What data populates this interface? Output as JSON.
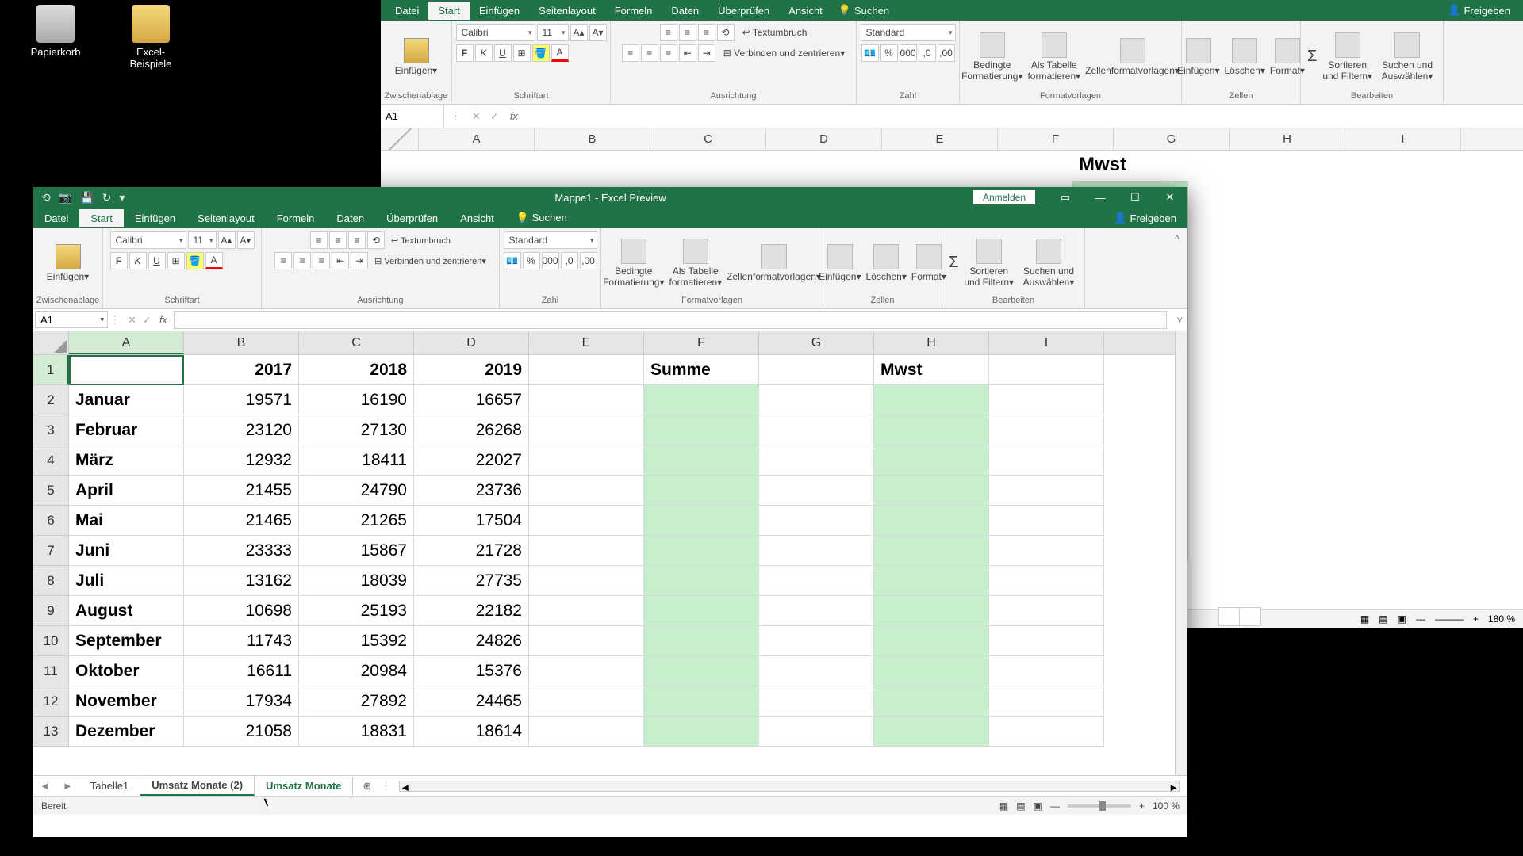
{
  "desktop": {
    "icon1": "Papierkorb",
    "icon2": "Excel-Beispiele"
  },
  "bg": {
    "tabs": [
      "Datei",
      "Start",
      "Einfügen",
      "Seitenlayout",
      "Formeln",
      "Daten",
      "Überprüfen",
      "Ansicht"
    ],
    "search": "Suchen",
    "share": "Freigeben",
    "font": "Calibri",
    "size": "11",
    "numfmt": "Standard",
    "groups": {
      "clipboard": "Zwischenablage",
      "font": "Schriftart",
      "align": "Ausrichtung",
      "number": "Zahl",
      "styles": "Formatvorlagen",
      "cells": "Zellen",
      "edit": "Bearbeiten"
    },
    "buttons": {
      "paste": "Einfügen",
      "wrap": "Textumbruch",
      "merge": "Verbinden und zentrieren",
      "condfmt": "Bedingte Formatierung",
      "table": "Als Tabelle formatieren",
      "cellstyles": "Zellenformatvorlagen",
      "insert": "Einfügen",
      "delete": "Löschen",
      "format": "Format",
      "sort": "Sortieren und Filtern",
      "find": "Suchen und Auswählen"
    },
    "namebox": "A1",
    "cols": [
      "A",
      "B",
      "C",
      "D",
      "E",
      "F",
      "G",
      "H",
      "I"
    ],
    "mwst": "Mwst",
    "zoom": "180 %"
  },
  "fg": {
    "title": "Mappe1  -  Excel Preview",
    "anmelden": "Anmelden",
    "tabs": [
      "Datei",
      "Start",
      "Einfügen",
      "Seitenlayout",
      "Formeln",
      "Daten",
      "Überprüfen",
      "Ansicht"
    ],
    "search": "Suchen",
    "share": "Freigeben",
    "font": "Calibri",
    "size": "11",
    "numfmt": "Standard",
    "groups": {
      "clipboard": "Zwischenablage",
      "font": "Schriftart",
      "align": "Ausrichtung",
      "number": "Zahl",
      "styles": "Formatvorlagen",
      "cells": "Zellen",
      "edit": "Bearbeiten"
    },
    "buttons": {
      "paste": "Einfügen",
      "wrap": "Textumbruch",
      "merge": "Verbinden und zentrieren",
      "condfmt": "Bedingte Formatierung",
      "table": "Als Tabelle formatieren",
      "cellstyles": "Zellenformatvorlagen",
      "insert": "Einfügen",
      "delete": "Löschen",
      "format": "Format",
      "sort": "Sortieren und Filtern",
      "find": "Suchen und Auswählen"
    },
    "namebox": "A1",
    "cols": [
      "A",
      "B",
      "C",
      "D",
      "E",
      "F",
      "G",
      "H",
      "I"
    ],
    "header_row": [
      "",
      "2017",
      "2018",
      "2019",
      "",
      "Summe",
      "",
      "Mwst",
      ""
    ],
    "data": [
      [
        "Januar",
        "19571",
        "16190",
        "16657"
      ],
      [
        "Februar",
        "23120",
        "27130",
        "26268"
      ],
      [
        "März",
        "12932",
        "18411",
        "22027"
      ],
      [
        "April",
        "21455",
        "24790",
        "23736"
      ],
      [
        "Mai",
        "21465",
        "21265",
        "17504"
      ],
      [
        "Juni",
        "23333",
        "15867",
        "21728"
      ],
      [
        "Juli",
        "13162",
        "18039",
        "27735"
      ],
      [
        "August",
        "10698",
        "25193",
        "22182"
      ],
      [
        "September",
        "11743",
        "15392",
        "24826"
      ],
      [
        "Oktober",
        "16611",
        "20984",
        "15376"
      ],
      [
        "November",
        "17934",
        "27892",
        "24465"
      ],
      [
        "Dezember",
        "21058",
        "18831",
        "18614"
      ]
    ],
    "sheets": [
      "Tabelle1",
      "Umsatz Monate (2)",
      "Umsatz Monate"
    ],
    "status": "Bereit",
    "zoom": "100 %"
  }
}
